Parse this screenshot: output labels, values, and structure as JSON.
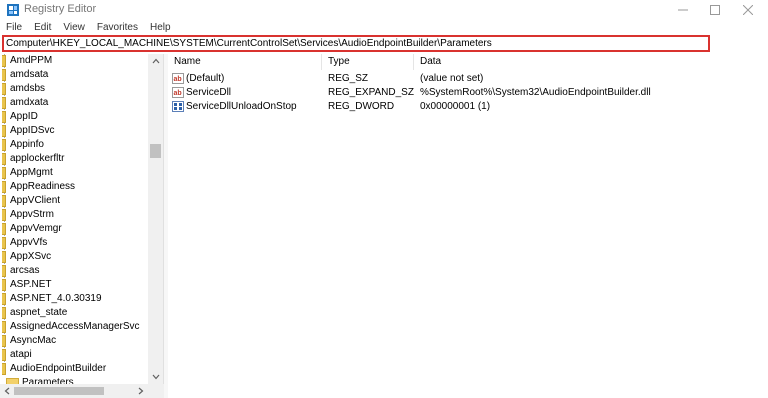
{
  "window": {
    "title": "Registry Editor",
    "app_icon": "registry-editor-icon"
  },
  "menu": [
    "File",
    "Edit",
    "View",
    "Favorites",
    "Help"
  ],
  "address": {
    "path": "Computer\\HKEY_LOCAL_MACHINE\\SYSTEM\\CurrentControlSet\\Services\\AudioEndpointBuilder\\Parameters",
    "highlight_color": "#d9322f"
  },
  "tree": {
    "items": [
      "AmdPPM",
      "amdsata",
      "amdsbs",
      "amdxata",
      "AppID",
      "AppIDSvc",
      "Appinfo",
      "applockerfltr",
      "AppMgmt",
      "AppReadiness",
      "AppVClient",
      "AppvStrm",
      "AppvVemgr",
      "AppvVfs",
      "AppXSvc",
      "arcsas",
      "ASP.NET",
      "ASP.NET_4.0.30319",
      "aspnet_state",
      "AssignedAccessManagerSvc",
      "AsyncMac",
      "atapi",
      "AudioEndpointBuilder"
    ],
    "selected": "Parameters",
    "folder_color": "#e9c44c"
  },
  "list": {
    "headers": {
      "name": "Name",
      "type": "Type",
      "data": "Data"
    },
    "rows": [
      {
        "name": "(Default)",
        "type": "REG_SZ",
        "data": "(value not set)",
        "icon": "string-value-icon"
      },
      {
        "name": "ServiceDll",
        "type": "REG_EXPAND_SZ",
        "data": "%SystemRoot%\\System32\\AudioEndpointBuilder.dll",
        "icon": "string-value-icon"
      },
      {
        "name": "ServiceDllUnloadOnStop",
        "type": "REG_DWORD",
        "data": "0x00000001 (1)",
        "icon": "binary-value-icon"
      }
    ]
  }
}
